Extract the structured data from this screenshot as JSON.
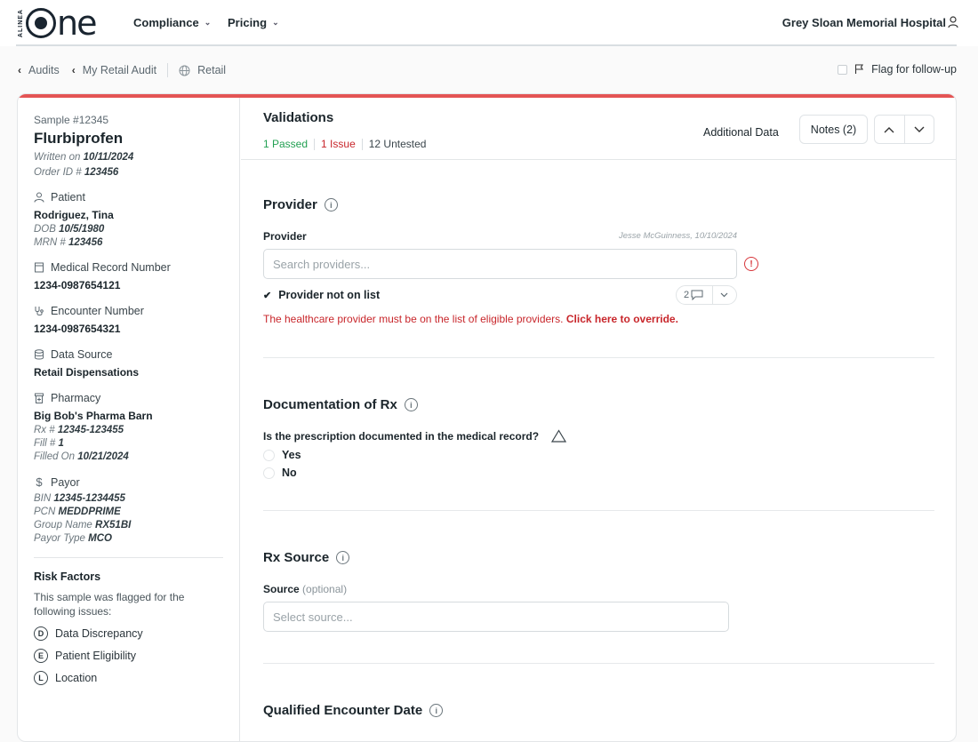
{
  "header": {
    "logo_small": "ALINEA",
    "logo_word": "ne",
    "nav": [
      {
        "label": "Compliance"
      },
      {
        "label": "Pricing"
      }
    ],
    "hospital": "Grey Sloan Memorial Hospital"
  },
  "breadcrumb": {
    "items": [
      "Audits",
      "My Retail Audit",
      "Retail"
    ],
    "flag_label": "Flag for follow-up"
  },
  "sample": {
    "number": "Sample #12345",
    "drug": "Flurbiprofen",
    "written_label": "Written on",
    "written_on": "10/11/2024",
    "order_label": "Order ID #",
    "order_id": "123456",
    "patient_heading": "Patient",
    "patient_name": "Rodriguez, Tina",
    "dob_label": "DOB",
    "dob": "10/5/1980",
    "mrn_label": "MRN #",
    "mrn": "123456",
    "mrn_heading": "Medical Record Number",
    "mrn_value": "1234-0987654121",
    "encounter_heading": "Encounter Number",
    "encounter_value": "1234-0987654321",
    "data_source_heading": "Data Source",
    "data_source_value": "Retail Dispensations",
    "pharmacy_heading": "Pharmacy",
    "pharmacy_name": "Big Bob's Pharma Barn",
    "rx_label": "Rx #",
    "rx_no": "12345-123455",
    "fill_label": "Fill #",
    "fill_no": "1",
    "filled_label": "Filled On",
    "filled_on": "10/21/2024",
    "payor_heading": "Payor",
    "bin_label": "BIN",
    "bin": "12345-1234455",
    "pcn_label": "PCN",
    "pcn": "MEDDPRIME",
    "group_label": "Group Name",
    "group": "RX51BI",
    "payor_type_label": "Payor Type",
    "payor_type": "MCO"
  },
  "risk": {
    "title": "Risk Factors",
    "desc": "This sample was flagged for the following issues:",
    "items": [
      {
        "badge": "D",
        "label": "Data Discrepancy"
      },
      {
        "badge": "E",
        "label": "Patient Eligibility"
      },
      {
        "badge": "L",
        "label": "Location"
      }
    ]
  },
  "validations": {
    "title": "Validations",
    "passed": "1 Passed",
    "issue": "1 Issue",
    "untested": "12 Untested",
    "additional_data": "Additional Data",
    "notes_label": "Notes (2)"
  },
  "provider": {
    "title": "Provider",
    "field_label": "Provider",
    "audit_stamp": "Jesse McGuinness, 10/10/2024",
    "placeholder": "Search providers...",
    "checkbox_label": "Provider not on list",
    "comment_count": "2",
    "error_text": "The healthcare provider must be on the list of eligible providers.",
    "error_link": "Click here to override."
  },
  "documentation": {
    "title": "Documentation of Rx",
    "question": "Is the prescription documented in the medical record?",
    "options": [
      "Yes",
      "No"
    ]
  },
  "rx_source": {
    "title": "Rx Source",
    "field_label": "Source",
    "optional": "(optional)",
    "placeholder": "Select source..."
  },
  "encounter_date": {
    "title": "Qualified Encounter Date"
  },
  "colors": {
    "accent_red": "#e45454",
    "pass_green": "#22a052",
    "issue_red": "#c8262b"
  }
}
